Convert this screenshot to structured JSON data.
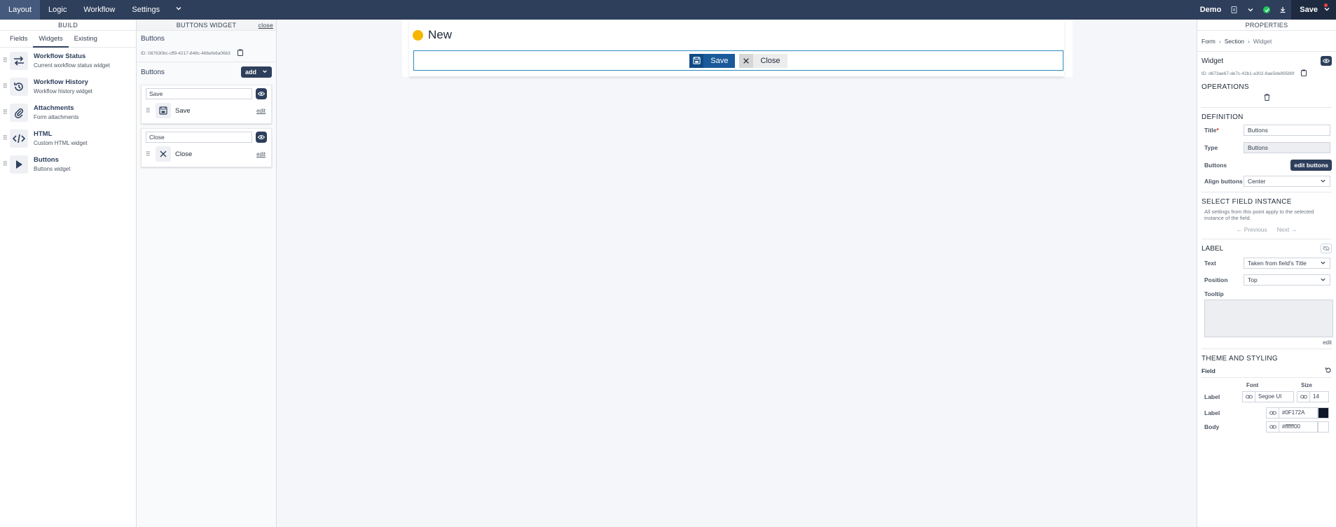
{
  "topbar": {
    "nav": [
      "Layout",
      "Logic",
      "Workflow",
      "Settings"
    ],
    "workspace": "Demo",
    "save_label": "Save"
  },
  "build": {
    "title": "BUILD",
    "tabs": [
      "Fields",
      "Widgets",
      "Existing"
    ],
    "widgets": [
      {
        "name": "Workflow Status",
        "desc": "Current workflow status widget",
        "icon": "workflow-status-icon"
      },
      {
        "name": "Workflow History",
        "desc": "Workflow history widget",
        "icon": "history-icon"
      },
      {
        "name": "Attachments",
        "desc": "Form attachments",
        "icon": "paperclip-icon"
      },
      {
        "name": "HTML",
        "desc": "Custom HTML widget",
        "icon": "code-icon"
      },
      {
        "name": "Buttons",
        "desc": "Buttons widget",
        "icon": "play-icon"
      }
    ]
  },
  "buttons_widget": {
    "title": "BUTTONS WIDGET",
    "close_label": "close",
    "section_title": "Buttons",
    "id_text": "ID: 087630bc-cff9-4217-848c-466efe6a06b3",
    "buttons_label": "Buttons",
    "add_label": "add",
    "items": [
      {
        "value": "Save",
        "label": "Save",
        "icon": "save-icon",
        "edit": "edit"
      },
      {
        "value": "Close",
        "label": "Close",
        "icon": "close-icon",
        "edit": "edit"
      }
    ]
  },
  "canvas": {
    "form_title": "New",
    "status_color": "#F5B700",
    "buttons": [
      {
        "label": "Save",
        "icon": "save-icon"
      },
      {
        "label": "Close",
        "icon": "close-icon"
      }
    ]
  },
  "properties": {
    "title": "PROPERTIES",
    "breadcrumb": [
      "Form",
      "Section",
      "Widget"
    ],
    "widget_label": "Widget",
    "id_text": "ID: d673ae67-de7c-42b1-a302-8ae5de89589f",
    "operations_title": "OPERATIONS",
    "definition_title": "DEFINITION",
    "title_label": "Title",
    "title_value": "Buttons",
    "type_label": "Type",
    "type_value": "Buttons",
    "buttons_label": "Buttons",
    "edit_buttons_label": "edit buttons",
    "align_label": "Align buttons",
    "align_value": "Center",
    "select_instance_title": "SELECT FIELD INSTANCE",
    "select_instance_hint": "All settings from this point apply to the selected instance of the field.",
    "previous_label": "Previous",
    "next_label": "Next",
    "label_title": "LABEL",
    "text_label": "Text",
    "text_value": "Taken from field's Title",
    "position_label": "Position",
    "position_value": "Top",
    "tooltip_label": "Tooltip",
    "tooltip_edit": "edit",
    "theme_title": "THEME AND STYLING",
    "field_label": "Field",
    "font_head": "Font",
    "size_head": "Size",
    "row_label_1": "Label",
    "font_value": "Segoe UI",
    "size_value": "14",
    "row_label_2": "Label",
    "label_color": "#0F172A",
    "row_label_3": "Body",
    "body_color": "#ffffff00"
  }
}
